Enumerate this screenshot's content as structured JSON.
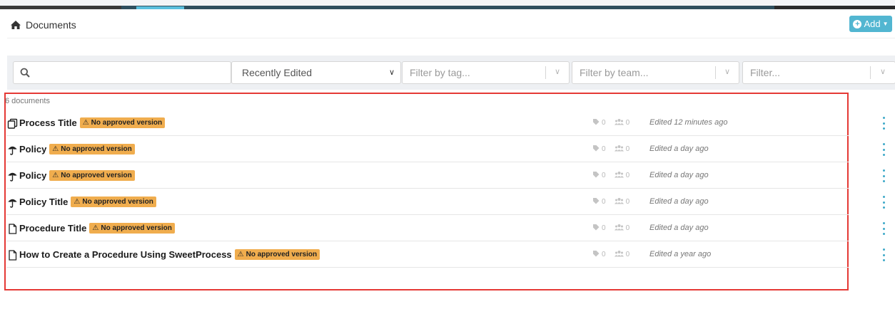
{
  "breadcrumb": {
    "title": "Documents"
  },
  "add_button": {
    "label": "Add"
  },
  "filters": {
    "search_placeholder": "",
    "sort_value": "Recently Edited",
    "tag_placeholder": "Filter by tag...",
    "team_placeholder": "Filter by team...",
    "other_placeholder": "Filter..."
  },
  "list": {
    "count": "6 documents",
    "badge_text": "No approved version",
    "items": [
      {
        "icon": "copy-icon",
        "title": "Process Title",
        "tags": "0",
        "teams": "0",
        "edited": "Edited 12 minutes ago"
      },
      {
        "icon": "umbrella-icon",
        "title": "Policy",
        "tags": "0",
        "teams": "0",
        "edited": "Edited a day ago"
      },
      {
        "icon": "umbrella-icon",
        "title": "Policy",
        "tags": "0",
        "teams": "0",
        "edited": "Edited a day ago"
      },
      {
        "icon": "umbrella-icon",
        "title": "Policy Title",
        "tags": "0",
        "teams": "0",
        "edited": "Edited a day ago"
      },
      {
        "icon": "file-icon",
        "title": "Procedure Title",
        "tags": "0",
        "teams": "0",
        "edited": "Edited a day ago"
      },
      {
        "icon": "file-icon",
        "title": "How to Create a Procedure Using SweetProcess",
        "tags": "0",
        "teams": "0",
        "edited": "Edited a year ago"
      }
    ]
  },
  "colors": {
    "accent": "#52b6d1",
    "badge": "#f0ad4e",
    "highlight_border": "#e53935",
    "header_dark": "#2f4f5e"
  }
}
